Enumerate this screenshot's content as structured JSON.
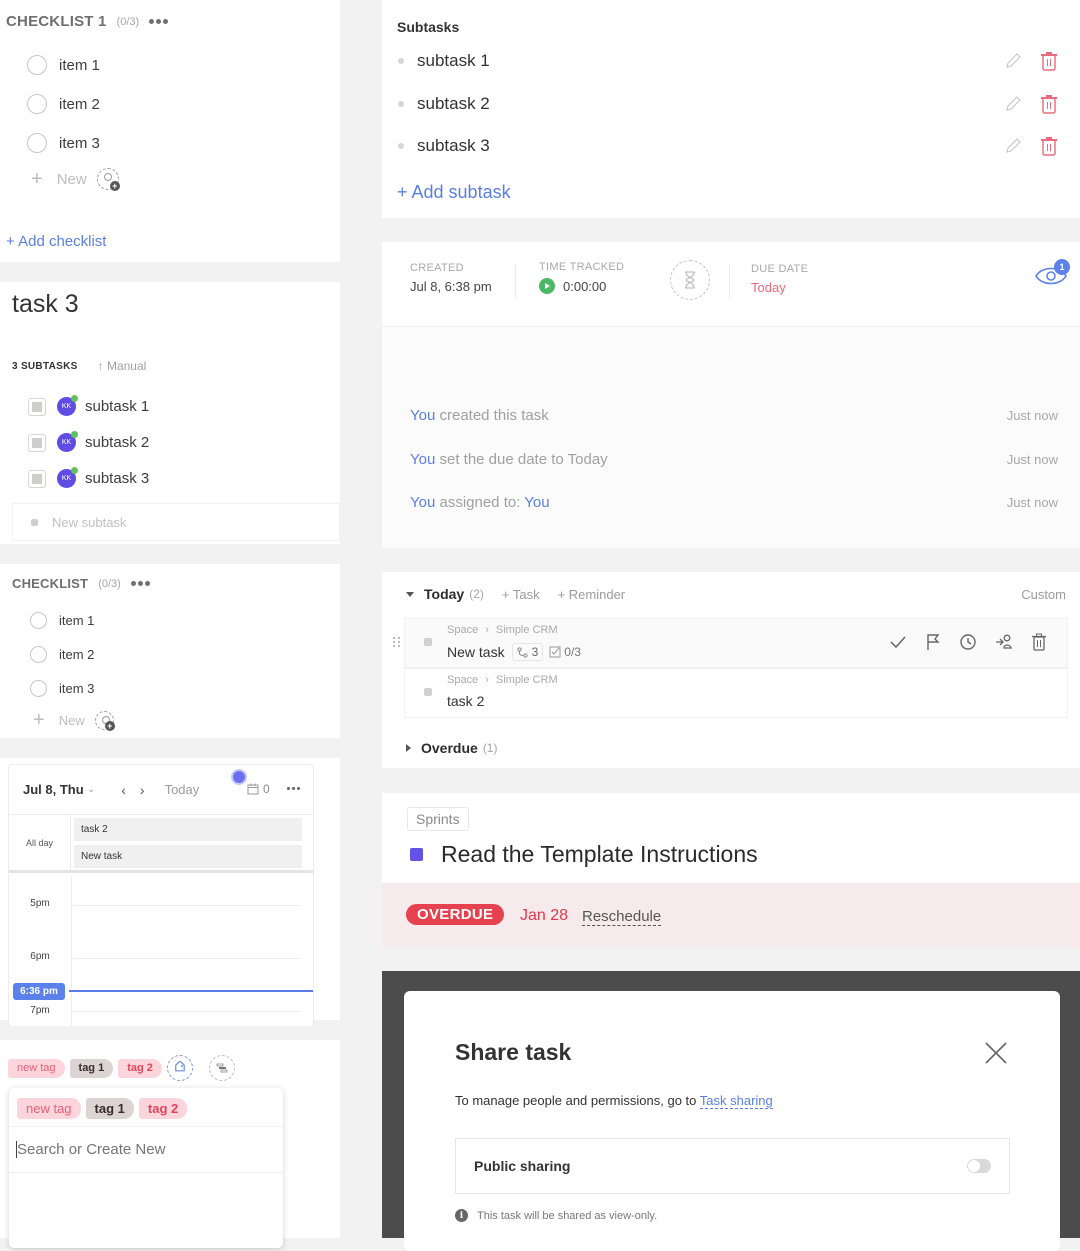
{
  "checklist1": {
    "title": "CHECKLIST 1",
    "count": "(0/3)",
    "items": [
      {
        "label": "item 1"
      },
      {
        "label": "item 2"
      },
      {
        "label": "item 3"
      }
    ],
    "new_label": "New",
    "add_checklist": "+ Add checklist"
  },
  "task3": {
    "title": "task 3",
    "subtask_count": "3 SUBTASKS",
    "sort_label": "Manual",
    "subtasks": [
      {
        "label": "subtask 1",
        "avatar": "KK"
      },
      {
        "label": "subtask 2",
        "avatar": "KK"
      },
      {
        "label": "subtask 3",
        "avatar": "KK"
      }
    ],
    "new_subtask_placeholder": "New subtask"
  },
  "checklist2": {
    "title": "CHECKLIST",
    "count": "(0/3)",
    "items": [
      {
        "label": "item 1"
      },
      {
        "label": "item 2"
      },
      {
        "label": "item 3"
      }
    ],
    "new_label": "New"
  },
  "calendar": {
    "date_label": "Jul 8, Thu",
    "today_label": "Today",
    "count": "0",
    "allday_label": "All day",
    "allday_events": [
      "task 2",
      "New task"
    ],
    "hours": [
      "5pm",
      "6pm",
      "7pm"
    ],
    "now_label": "6:36 pm"
  },
  "tags": {
    "applied": [
      "new tag",
      "tag 1",
      "tag 2"
    ],
    "dropdown_tags": [
      "new tag",
      "tag 1",
      "tag 2"
    ],
    "search_placeholder": "Search or Create New"
  },
  "subtasks_panel": {
    "title": "Subtasks",
    "items": [
      {
        "label": "subtask 1"
      },
      {
        "label": "subtask 2"
      },
      {
        "label": "subtask 3"
      }
    ],
    "add_label": "+ Add subtask"
  },
  "meta": {
    "created_label": "CREATED",
    "created_value": "Jul 8, 6:38 pm",
    "time_tracked_label": "TIME TRACKED",
    "time_tracked_value": "0:00:00",
    "due_label": "DUE DATE",
    "due_value": "Today",
    "watchers_count": "1"
  },
  "activity": [
    {
      "actor": "You",
      "text": " created this task",
      "target": "",
      "time": "Just now"
    },
    {
      "actor": "You",
      "text": " set the due date to Today",
      "target": "",
      "time": "Just now"
    },
    {
      "actor": "You",
      "text": " assigned to: ",
      "target": "You",
      "time": "Just now"
    }
  ],
  "today_list": {
    "title": "Today",
    "count": "(2)",
    "add_task": "+ Task",
    "add_reminder": "+ Reminder",
    "custom": "Custom",
    "tasks": [
      {
        "path": [
          "Space",
          "Simple CRM"
        ],
        "name": "New task",
        "subtask_count": "3",
        "checklist": "0/3"
      },
      {
        "path": [
          "Space",
          "Simple CRM"
        ],
        "name": "task 2"
      }
    ],
    "overdue_title": "Overdue",
    "overdue_count": "(1)"
  },
  "sprint": {
    "chip": "Sprints",
    "title": "Read the Template Instructions",
    "status_color": "#6352e8",
    "overdue_badge": "OVERDUE",
    "due_date": "Jan 28",
    "reschedule": "Reschedule"
  },
  "share": {
    "title": "Share task",
    "desc_prefix": "To manage people and permissions, go to ",
    "desc_link": "Task sharing",
    "public_label": "Public sharing",
    "public_enabled": false,
    "info": "This task will be shared as view-only."
  },
  "colors": {
    "accent_blue": "#5b7fe0",
    "danger_red": "#e5414f",
    "avatar_purple": "#5f4de3",
    "online_green": "#5ec25f"
  }
}
